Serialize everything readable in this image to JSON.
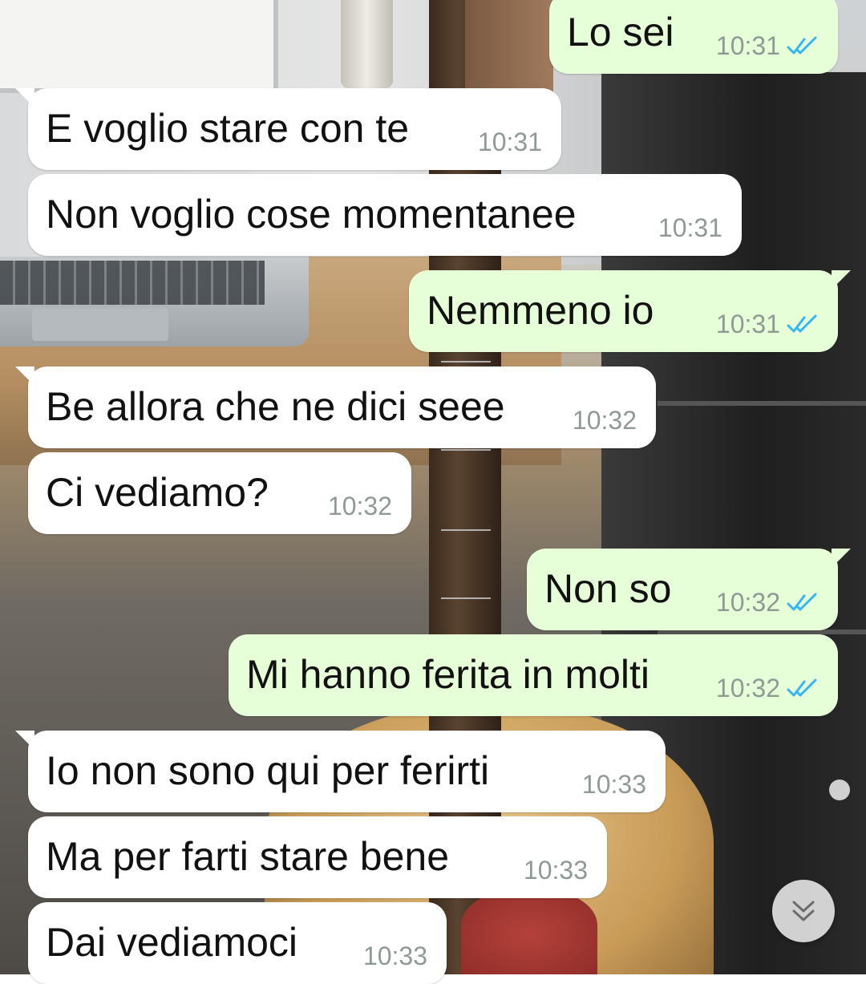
{
  "messages": [
    {
      "direction": "outgoing",
      "text": "Lo sei",
      "time": "10:31",
      "status": "read"
    },
    {
      "direction": "incoming",
      "text": "E voglio stare con te",
      "time": "10:31"
    },
    {
      "direction": "incoming",
      "text": "Non voglio cose momentanee",
      "time": "10:31"
    },
    {
      "direction": "outgoing",
      "text": "Nemmeno io",
      "time": "10:31",
      "status": "read"
    },
    {
      "direction": "incoming",
      "text": "Be allora che ne dici seee",
      "time": "10:32"
    },
    {
      "direction": "incoming",
      "text": "Ci vediamo?",
      "time": "10:32"
    },
    {
      "direction": "outgoing",
      "text": "Non so",
      "time": "10:32",
      "status": "read"
    },
    {
      "direction": "outgoing",
      "text": "Mi hanno ferita in molti",
      "time": "10:32",
      "status": "read"
    },
    {
      "direction": "incoming",
      "text": "Io non sono qui per ferirti",
      "time": "10:33"
    },
    {
      "direction": "incoming",
      "text": "Ma per farti stare bene",
      "time": "10:33"
    },
    {
      "direction": "incoming",
      "text": "Dai vediamoci",
      "time": "10:33"
    }
  ],
  "scroll_down_button": {
    "icon": "chevron-double-down-icon"
  },
  "colors": {
    "incoming_bubble": "#ffffff",
    "outgoing_bubble": "#e6ffd9",
    "timestamp": "#8f9a94",
    "read_ticks": "#34b7f1"
  }
}
